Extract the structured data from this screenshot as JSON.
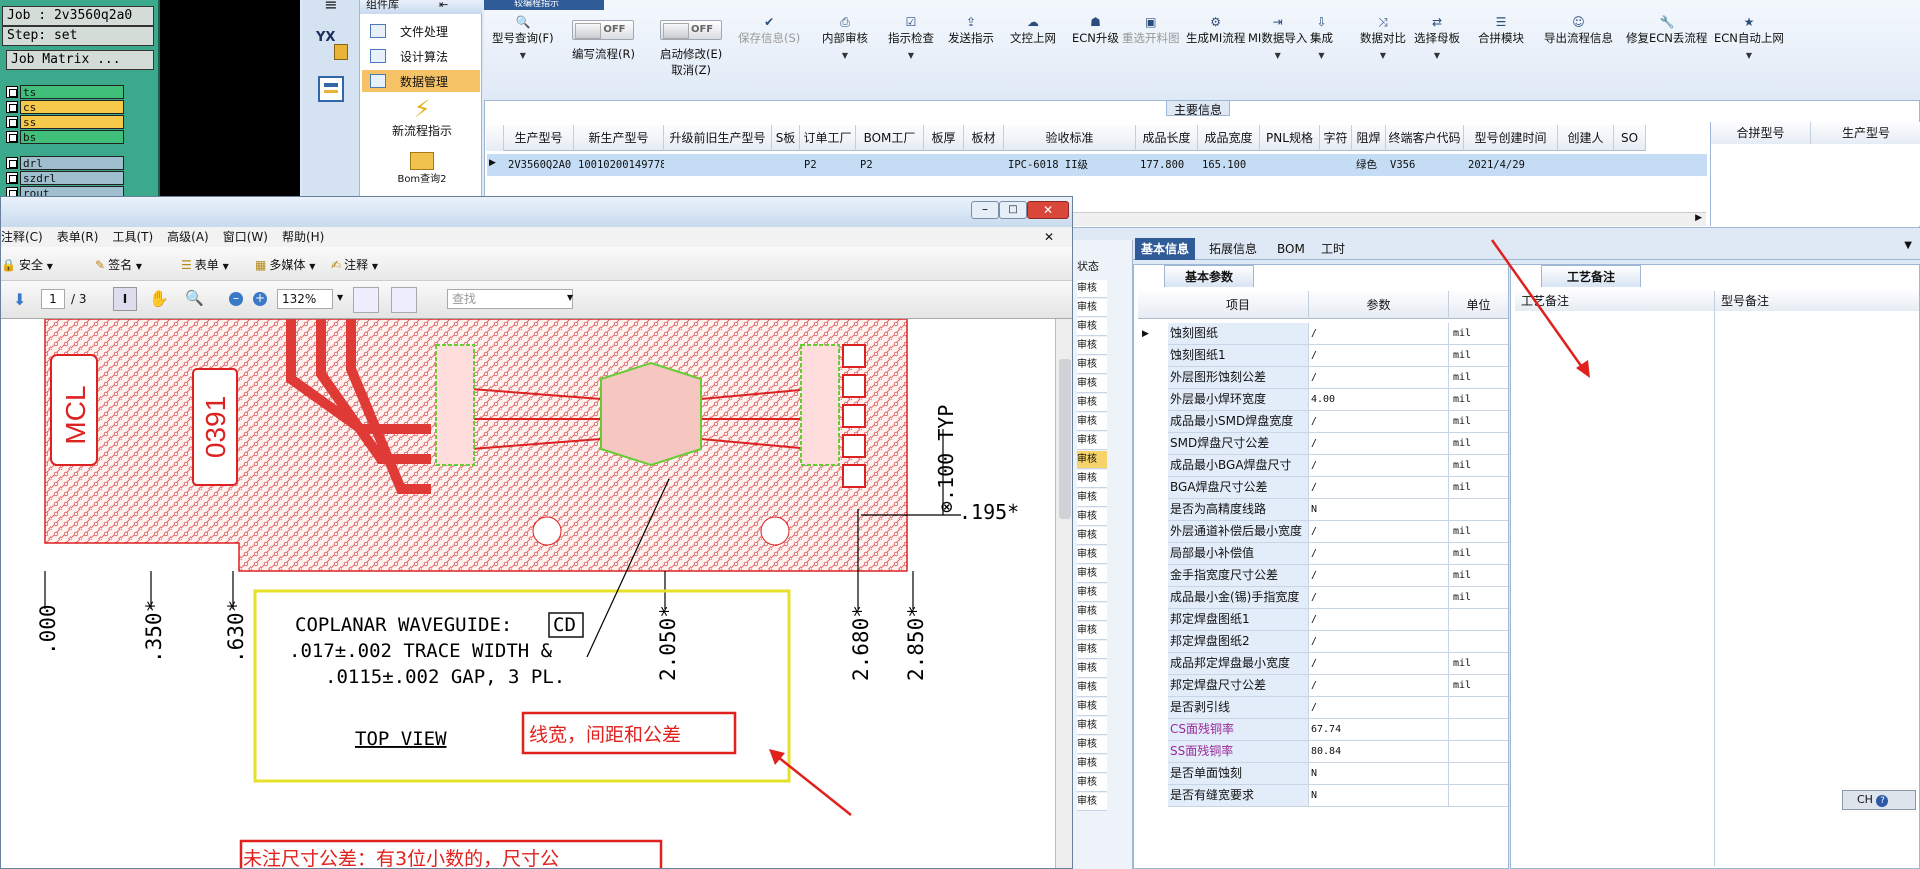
{
  "genesis": {
    "job_line": "Job : 2v3560q2a0",
    "step_line": "Step: set",
    "matrix_btn": "Job Matrix ...",
    "layers_top": [
      {
        "name": "ts",
        "color": "#3fbf7a"
      },
      {
        "name": "cs",
        "color": "#f6c94a"
      },
      {
        "name": "ss",
        "color": "#f6c94a"
      },
      {
        "name": "bs",
        "color": "#3fbf7a"
      }
    ],
    "layers_bottom": [
      {
        "name": "drl",
        "color": "#9fbfcf"
      },
      {
        "name": "szdrl",
        "color": "#9fbfcf"
      },
      {
        "name": "rout",
        "color": "#9fbfcf"
      }
    ]
  },
  "left_menu": {
    "header": "组件库",
    "items": [
      "文件处理",
      "设计算法",
      "数据管理"
    ],
    "selected_index": 2,
    "icon_labels": [
      "新流程指示",
      "Bom查询2"
    ],
    "logo_text": "YX"
  },
  "toolbar": {
    "tab_partial": "较编程指示",
    "buttons": [
      {
        "label": "型号查询(F)",
        "icon": "search-icon",
        "dropdown": true
      },
      {
        "label": "编写流程(R)",
        "icon": "toggle-icon",
        "toggle": "OFF"
      },
      {
        "label": "启动修改(E)",
        "label2": "取消(Z)",
        "icon": "toggle-icon",
        "toggle": "OFF"
      },
      {
        "label": "保存信息(S)",
        "icon": "check-icon",
        "disabled": true
      },
      {
        "label": "内部审核",
        "icon": "printer-icon",
        "dropdown": true
      },
      {
        "label": "指示检查",
        "icon": "check-box-icon",
        "dropdown": true
      },
      {
        "label": "发送指示",
        "icon": "upload-icon"
      },
      {
        "label": "文控上网",
        "icon": "cloud-upload-icon"
      },
      {
        "label": "ECN升级",
        "icon": "user-group-icon"
      },
      {
        "label": "重选开料图",
        "icon": "image-icon",
        "disabled": true
      },
      {
        "label": "生成MI流程",
        "icon": "cogs-icon"
      },
      {
        "label": "MI数据导入",
        "icon": "sign-in-icon",
        "dropdown": true
      },
      {
        "label": "集成",
        "icon": "download-icon",
        "dropdown": true
      },
      {
        "label": "数据对比",
        "icon": "compare-icon",
        "dropdown": true
      },
      {
        "label": "选择母板",
        "icon": "shuffle-icon",
        "dropdown": true
      },
      {
        "label": "合拼模块",
        "icon": "list-icon"
      },
      {
        "label": "导出流程信息",
        "icon": "smile-icon"
      },
      {
        "label": "修复ECN丢流程",
        "icon": "wrench-icon"
      },
      {
        "label": "ECN自动上网",
        "icon": "star-icon",
        "dropdown": true
      }
    ]
  },
  "main_info": {
    "title": "主要信息",
    "columns": [
      "生产型号",
      "新生产型号",
      "升级前旧生产型号",
      "S板",
      "订单工厂",
      "BOM工厂",
      "板厚",
      "板材",
      "验收标准",
      "成品长度",
      "成品宽度",
      "PNL规格",
      "字符",
      "阻焊",
      "终端客户代码",
      "型号创建时间",
      "创建人",
      "SO"
    ],
    "row": [
      "2V3560Q2A0",
      "10010200149778",
      "",
      "",
      "P2",
      "P2",
      "",
      "",
      "IPC-6018 II级",
      "177.800",
      "165.100",
      "",
      "",
      "绿色",
      "V356",
      "2021/4/29",
      "",
      ""
    ],
    "side_columns": [
      "合拼型号",
      "生产型号"
    ]
  },
  "pdf": {
    "menu": [
      "注释(C)",
      "表单(R)",
      "工具(T)",
      "高级(A)",
      "窗口(W)",
      "帮助(H)"
    ],
    "toolbar1": [
      "安全",
      "签名",
      "表单",
      "多媒体",
      "注释"
    ],
    "page_current": "1",
    "page_total": "/ 3",
    "zoom": "132%",
    "search_placeholder": "查找",
    "drawing": {
      "labels": [
        "MCL",
        "0391"
      ],
      "dims_v": [
        ".000",
        ".350*",
        ".630*",
        "2.050*",
        "2.680*",
        "2.850*"
      ],
      "dim_top": "⊗.100 TYP",
      "dim_right": ".195*",
      "note1": "COPLANAR WAVEGUIDE:",
      "note1_box": "CD",
      "note2": ".017±.002 TRACE WIDTH &",
      "note3": ".0115±.002 GAP, 3 PL.",
      "top_view": "TOP VIEW",
      "annot1": "线宽，间距和公差",
      "annot2": "未注尺寸公差：有3位小数的，尺寸公"
    }
  },
  "strip": {
    "header": "状态",
    "items": [
      "审核",
      "审核",
      "审核",
      "审核",
      "审核",
      "审核",
      "审核",
      "审核",
      "审核",
      "审核",
      "审核",
      "审核",
      "审核",
      "审核",
      "审核",
      "审核",
      "审核",
      "审核",
      "审核",
      "审核",
      "审核",
      "审核",
      "审核",
      "审核",
      "审核",
      "审核",
      "审核",
      "审核"
    ]
  },
  "tabs": {
    "items": [
      "基本信息",
      "拓展信息",
      "BOM",
      "工时"
    ],
    "active_index": 0
  },
  "basic_params": {
    "tab": "基本参数",
    "headers": [
      "项目",
      "参数",
      "单位"
    ],
    "rows": [
      {
        "item": "蚀刻图纸",
        "value": "/",
        "unit": "mil"
      },
      {
        "item": "蚀刻图纸1",
        "value": "/",
        "unit": "mil"
      },
      {
        "item": "外层图形蚀刻公差",
        "value": "/",
        "unit": "mil"
      },
      {
        "item": "外层最小焊环宽度",
        "value": "4.00",
        "unit": "mil"
      },
      {
        "item": "成品最小SMD焊盘宽度",
        "value": "/",
        "unit": "mil"
      },
      {
        "item": "SMD焊盘尺寸公差",
        "value": "/",
        "unit": "mil"
      },
      {
        "item": "成品最小BGA焊盘尺寸",
        "value": "/",
        "unit": "mil"
      },
      {
        "item": "BGA焊盘尺寸公差",
        "value": "/",
        "unit": "mil"
      },
      {
        "item": "是否为高精度线路",
        "value": "N",
        "unit": ""
      },
      {
        "item": "外层通道补偿后最小宽度",
        "value": "/",
        "unit": "mil"
      },
      {
        "item": "局部最小补偿值",
        "value": "/",
        "unit": "mil"
      },
      {
        "item": "金手指宽度尺寸公差",
        "value": "/",
        "unit": "mil"
      },
      {
        "item": "成品最小金(锡)手指宽度",
        "value": "/",
        "unit": "mil"
      },
      {
        "item": "邦定焊盘图纸1",
        "value": "/",
        "unit": ""
      },
      {
        "item": "邦定焊盘图纸2",
        "value": "/",
        "unit": ""
      },
      {
        "item": "成品邦定焊盘最小宽度",
        "value": "/",
        "unit": "mil"
      },
      {
        "item": "邦定焊盘尺寸公差",
        "value": "/",
        "unit": "mil"
      },
      {
        "item": "是否剥引线",
        "value": "/",
        "unit": ""
      },
      {
        "item": "CS面残铜率",
        "value": "67.74",
        "unit": "",
        "purple": true
      },
      {
        "item": "SS面残铜率",
        "value": "80.84",
        "unit": "",
        "purple": true
      },
      {
        "item": "是否单面蚀刻",
        "value": "N",
        "unit": ""
      },
      {
        "item": "是否有缝宽要求",
        "value": "N",
        "unit": ""
      }
    ]
  },
  "remarks": {
    "tab": "工艺备注",
    "col1": "工艺备注",
    "col2": "型号备注"
  },
  "ime": {
    "label": "CH"
  }
}
